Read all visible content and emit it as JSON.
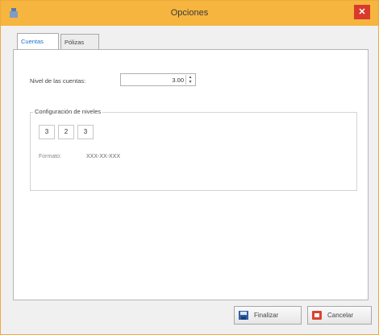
{
  "window": {
    "title": "Opciones"
  },
  "tabs": [
    {
      "label": "Cuentas",
      "active": true
    },
    {
      "label": "Pólizas",
      "active": false
    }
  ],
  "cuentas": {
    "level_label": "Nivel de las cuentas:",
    "level_value": "3.00",
    "group_legend": "Configuración de niveles",
    "levels": [
      "3",
      "2",
      "3"
    ],
    "format_label": "Formato:",
    "format_value": "XXX-XX-XXX"
  },
  "footer": {
    "finish_label": "Finalizar",
    "cancel_label": "Cancelar"
  },
  "colors": {
    "titlebar": "#f6b53f",
    "close": "#d83b2b",
    "active_tab_text": "#1e6fc7"
  }
}
